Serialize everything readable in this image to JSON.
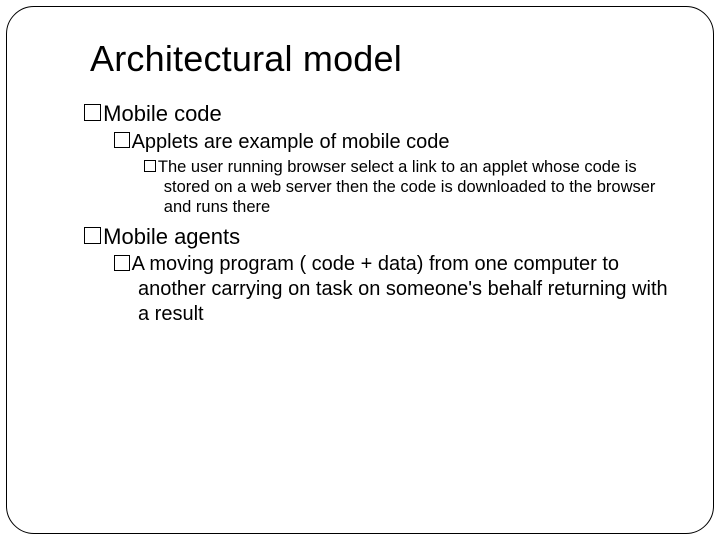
{
  "title": "Architectural model",
  "items": {
    "mobileCode": "Mobile code",
    "applets": "Applets are example of mobile code",
    "appletsDetail": "The user running browser select a link to an applet whose code is stored on a web server then the code is downloaded to the browser and runs there",
    "mobileAgents": "Mobile agents",
    "agentsDetail": "A moving program ( code + data) from one computer to another carrying on task on someone's behalf returning with a result"
  }
}
